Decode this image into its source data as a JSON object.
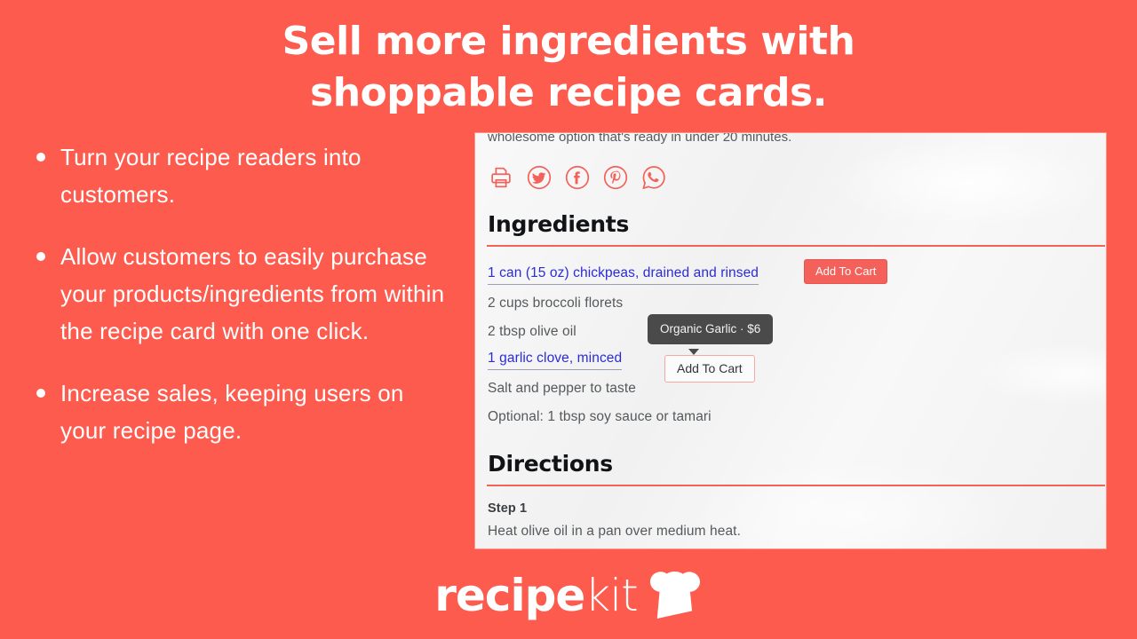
{
  "colors": {
    "background": "#fc5b4e",
    "card_bg": "#f1f1f1",
    "accent_red": "#f4605a",
    "link_blue": "#2b2bd8",
    "tooltip_bg": "#4a4a4a",
    "text_gray": "#55595c",
    "heading_black": "#111316",
    "white": "#ffffff"
  },
  "headline": "Sell more ingredients with\nshoppable recipe cards.",
  "bullets": [
    {
      "text": "Turn your recipe readers into customers."
    },
    {
      "text": "Allow customers to easily purchase your products/ingredients from within the recipe card with one click."
    },
    {
      "text": "Increase sales, keeping users on your recipe page."
    }
  ],
  "card": {
    "intro_text": "wholesome option that's ready in under 20 minutes.",
    "social": [
      {
        "name": "print-icon",
        "label": "Print"
      },
      {
        "name": "twitter-icon",
        "label": "Twitter"
      },
      {
        "name": "facebook-icon",
        "label": "Facebook"
      },
      {
        "name": "pinterest-icon",
        "label": "Pinterest"
      },
      {
        "name": "whatsapp-icon",
        "label": "WhatsApp"
      }
    ],
    "ingredients_heading": "Ingredients",
    "ingredients": [
      {
        "text": "1 can (15 oz) chickpeas, drained and rinsed",
        "shoppable": true
      },
      {
        "text": "2 cups broccoli florets",
        "shoppable": false
      },
      {
        "text": "2 tbsp olive oil",
        "shoppable": false
      },
      {
        "text": "1 garlic clove, minced",
        "shoppable": true
      },
      {
        "text": "Salt and pepper to taste",
        "shoppable": false
      },
      {
        "text": "Optional: 1 tbsp soy sauce or tamari",
        "shoppable": false
      }
    ],
    "add_to_cart_primary_label": "Add To Cart",
    "tooltip": {
      "product_name": "Organic Garlic",
      "separator": "·",
      "price": "$6",
      "full_text": "Organic Garlic · $6"
    },
    "add_to_cart_secondary_label": "Add To Cart",
    "directions_heading": "Directions",
    "steps": [
      {
        "label": "Step 1",
        "text": "Heat olive oil in a pan over medium heat."
      }
    ]
  },
  "logo": {
    "bold_part": "recipe",
    "light_part": "kit",
    "icon": "chef-hat-icon"
  }
}
